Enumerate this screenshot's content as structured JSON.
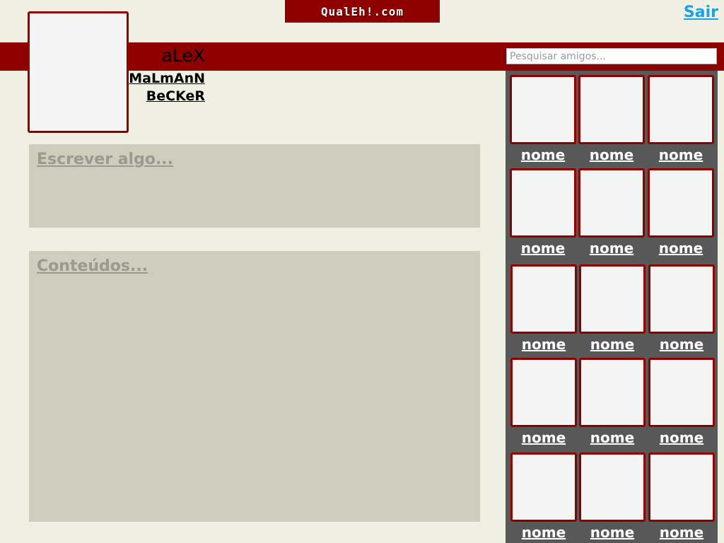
{
  "header": {
    "logo_text": "QualEh!.com",
    "logout_label": "Sair"
  },
  "profile": {
    "first_name": "aLeX",
    "last_name_line1": "MaLmAnN",
    "last_name_line2": "BeCKeR"
  },
  "search": {
    "placeholder": "Pesquisar amigos..."
  },
  "main": {
    "post_placeholder": "Escrever algo...",
    "content_label": "Conteúdos..."
  },
  "friends": [
    {
      "name": "nome"
    },
    {
      "name": "nome"
    },
    {
      "name": "nome"
    },
    {
      "name": "nome"
    },
    {
      "name": "nome"
    },
    {
      "name": "nome"
    },
    {
      "name": "nome"
    },
    {
      "name": "nome"
    },
    {
      "name": "nome"
    },
    {
      "name": "nome"
    },
    {
      "name": "nome"
    },
    {
      "name": "nome"
    },
    {
      "name": "nome"
    },
    {
      "name": "nome"
    },
    {
      "name": "nome"
    }
  ],
  "colors": {
    "brand_red": "#8e0000",
    "background": "#f0f0e2",
    "panel_gray": "#585858",
    "box_gray": "#cdcebd",
    "link_blue": "#1aa3e8"
  }
}
